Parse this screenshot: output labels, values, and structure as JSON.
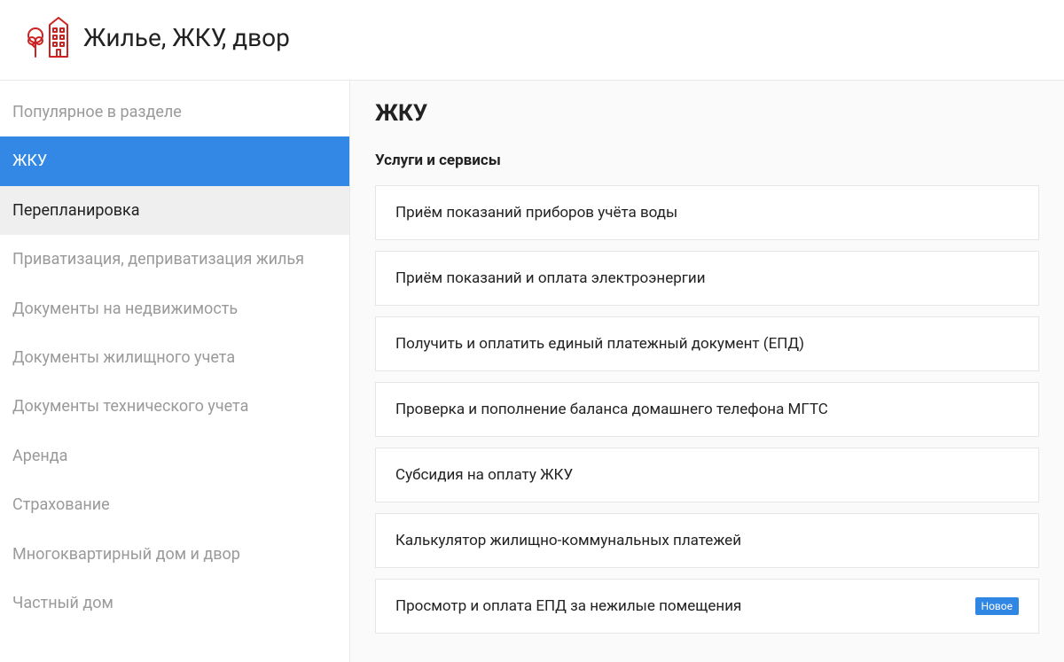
{
  "header": {
    "title": "Жилье, ЖКУ, двор"
  },
  "sidebar": {
    "items": [
      {
        "label": "Популярное в разделе",
        "state": "normal"
      },
      {
        "label": "ЖКУ",
        "state": "active"
      },
      {
        "label": "Перепланировка",
        "state": "hovered"
      },
      {
        "label": "Приватизация, деприватизация жилья",
        "state": "normal"
      },
      {
        "label": "Документы на недвижимость",
        "state": "normal"
      },
      {
        "label": "Документы жилищного учета",
        "state": "normal"
      },
      {
        "label": "Документы технического учета",
        "state": "normal"
      },
      {
        "label": "Аренда",
        "state": "normal"
      },
      {
        "label": "Страхование",
        "state": "normal"
      },
      {
        "label": "Многоквартирный дом и двор",
        "state": "normal"
      },
      {
        "label": "Частный дом",
        "state": "normal"
      }
    ]
  },
  "main": {
    "title": "ЖКУ",
    "subtitle": "Услуги и сервисы",
    "services": [
      {
        "label": "Приём показаний приборов учёта воды",
        "badge": null
      },
      {
        "label": "Приём показаний и оплата электроэнергии",
        "badge": null
      },
      {
        "label": "Получить и оплатить единый платежный документ (ЕПД)",
        "badge": null
      },
      {
        "label": "Проверка и пополнение баланса домашнего телефона МГТС",
        "badge": null
      },
      {
        "label": "Субсидия на оплату ЖКУ",
        "badge": null
      },
      {
        "label": "Калькулятор жилищно-коммунальных платежей",
        "badge": null
      },
      {
        "label": "Просмотр и оплата ЕПД за нежилые помещения",
        "badge": "Новое"
      }
    ]
  }
}
